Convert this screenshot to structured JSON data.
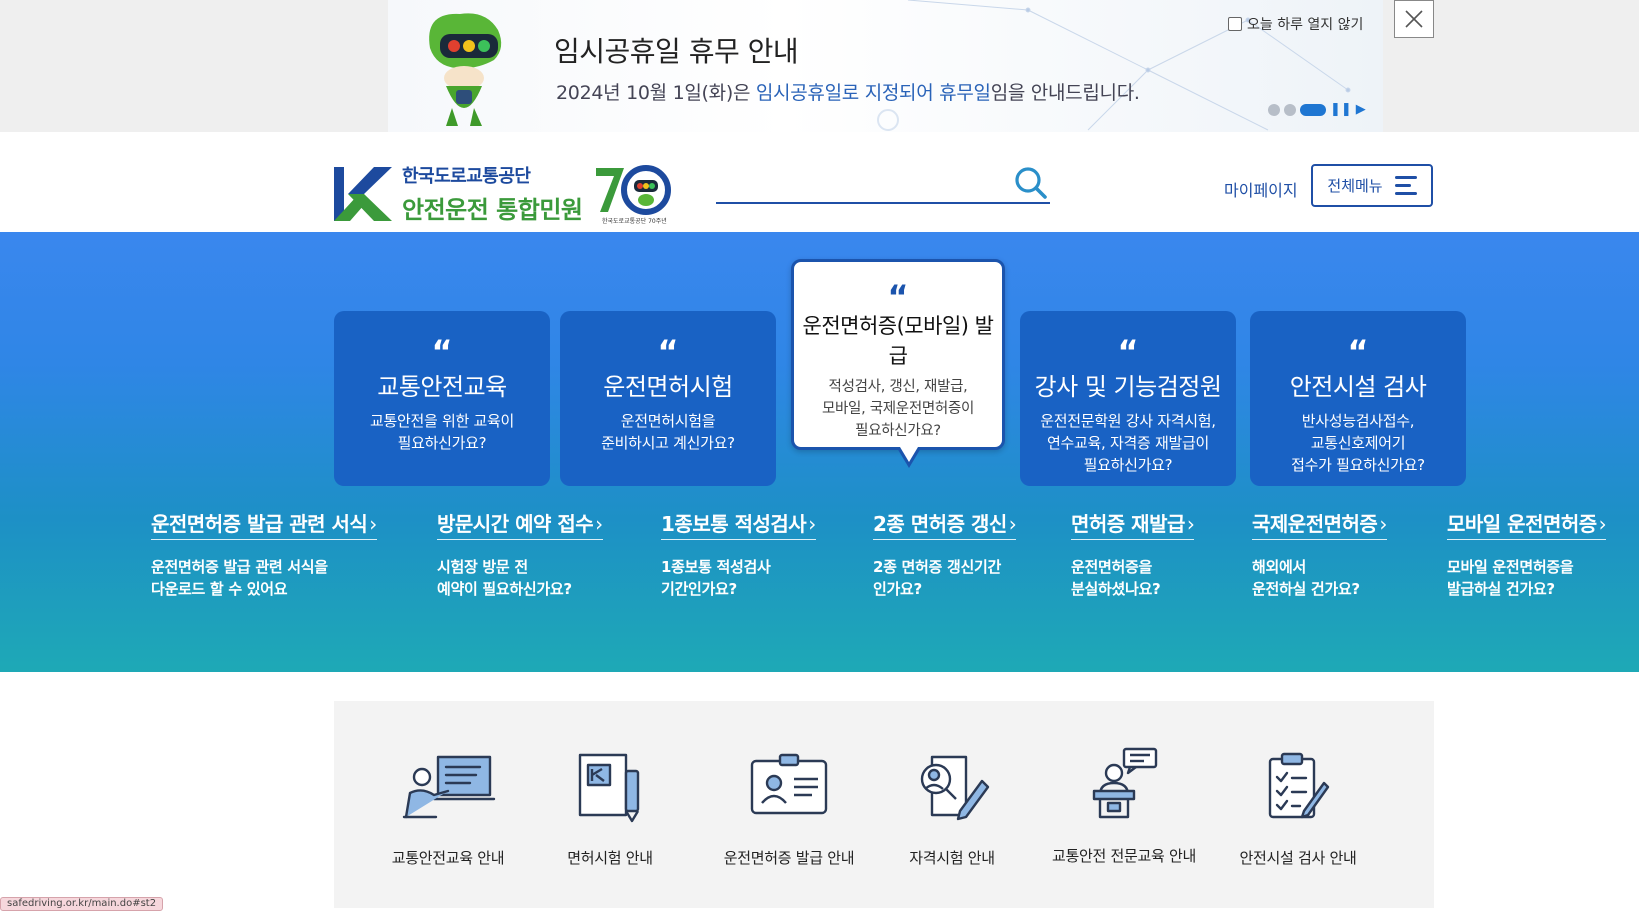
{
  "popup": {
    "title": "임시공휴일 휴무 안내",
    "desc_parts": [
      "2024년 10월 1일(화)은 ",
      "임시공휴일로 지정되어 휴무일",
      "임을 안내드립니다."
    ],
    "no_show_label": "오늘 하루 열지 않기",
    "slides_total": 3,
    "slide_active": 3
  },
  "header": {
    "org_name": "한국도로교통공단",
    "site_name": "안전운전 통합민원",
    "anniv_label": "한국도로교통공단 70주년",
    "search_value": "",
    "mypage_label": "마이페이지",
    "menu_label": "전체메뉴"
  },
  "cards": [
    {
      "quote": "“",
      "title": "교통안전교육",
      "desc1": "교통안전을 위한 교육이",
      "desc2": "필요하신가요?",
      "desc3": ""
    },
    {
      "quote": "“",
      "title": "운전면허시험",
      "desc1": "운전면허시험을",
      "desc2": "준비하시고 계신가요?",
      "desc3": ""
    },
    {
      "quote": "“",
      "title": "운전면허증(모바일) 발급",
      "desc1": "적성검사, 갱신, 재발급,",
      "desc2": "모바일, 국제운전면허증이",
      "desc3": "필요하신가요?"
    },
    {
      "quote": "“",
      "title": "강사 및 기능검정원",
      "desc1": "운전전문학원 강사 자격시험,",
      "desc2": "연수교육, 자격증 재발급이",
      "desc3": "필요하신가요?"
    },
    {
      "quote": "“",
      "title": "안전시설 검사",
      "desc1": "반사성능검사접수,",
      "desc2": "교통신호제어기",
      "desc3": "접수가 필요하신가요?"
    }
  ],
  "quick_links": [
    {
      "title": "운전면허증 발급 관련 서식",
      "desc1": "운전면허증 발급 관련 서식을",
      "desc2": "다운로드 할 수 있어요"
    },
    {
      "title": "방문시간 예약 접수",
      "desc1": "시험장 방문 전",
      "desc2": "예약이 필요하신가요?"
    },
    {
      "title": "1종보통 적성검사",
      "desc1": "1종보통 적성검사",
      "desc2": "기간인가요?"
    },
    {
      "title": "2종 면허증 갱신",
      "desc1": "2종 면허증 갱신기간",
      "desc2": "인가요?"
    },
    {
      "title": "면허증 재발급",
      "desc1": "운전면허증을",
      "desc2": "분실하셨나요?"
    },
    {
      "title": "국제운전면허증",
      "desc1": "해외에서",
      "desc2": "운전하실 건가요?"
    },
    {
      "title": "모바일 운전면허증",
      "desc1": "모바일 운전면허증을",
      "desc2": "발급하실 건가요?"
    }
  ],
  "quick_arrow": "›",
  "services": [
    {
      "label": "교통안전교육 안내",
      "icon": "teacher-board-icon"
    },
    {
      "label": "면허시험 안내",
      "icon": "license-pen-icon"
    },
    {
      "label": "운전면허증 발급 안내",
      "icon": "id-card-icon"
    },
    {
      "label": "자격시험 안내",
      "icon": "exam-paper-icon"
    },
    {
      "label": "교통안전 전문교육 안내",
      "icon": "lecturer-podium-icon"
    },
    {
      "label": "안전시설 검사 안내",
      "icon": "clipboard-check-icon"
    }
  ],
  "status_url": "safedriving.or.kr/main.do#st2",
  "colors": {
    "primary": "#1f4fa6",
    "card_blue": "#1962c4",
    "logo_green": "#3b9a3b",
    "hero_top": "#3a87ee",
    "hero_bottom": "#1ea9b6"
  }
}
